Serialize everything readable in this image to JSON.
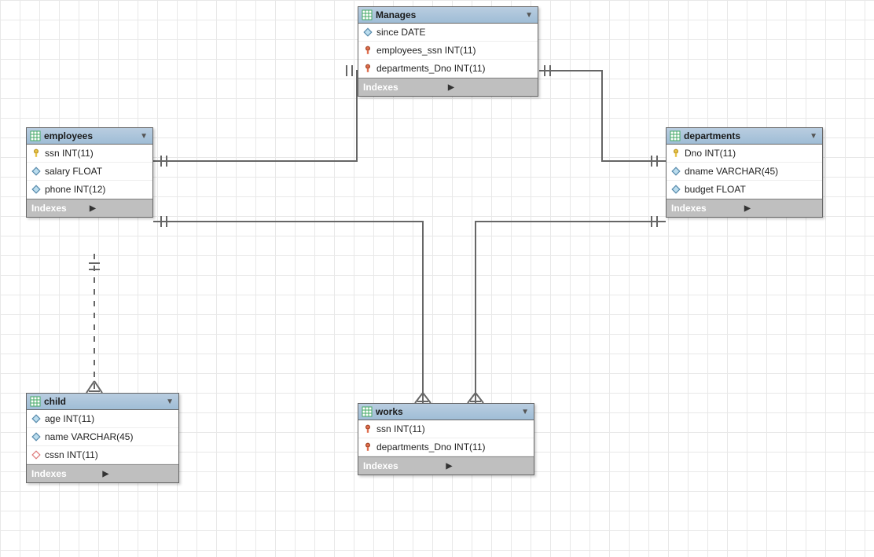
{
  "indexes_label": "Indexes",
  "tables": {
    "employees": {
      "name": "employees",
      "columns": [
        {
          "icon": "pk",
          "text": "ssn INT(11)"
        },
        {
          "icon": "attr",
          "text": "salary FLOAT"
        },
        {
          "icon": "attr",
          "text": "phone INT(12)"
        }
      ]
    },
    "manages": {
      "name": "Manages",
      "columns": [
        {
          "icon": "attr",
          "text": "since DATE"
        },
        {
          "icon": "fk",
          "text": "employees_ssn INT(11)"
        },
        {
          "icon": "fk",
          "text": "departments_Dno INT(11)"
        }
      ]
    },
    "departments": {
      "name": "departments",
      "columns": [
        {
          "icon": "pk",
          "text": "Dno INT(11)"
        },
        {
          "icon": "attr",
          "text": "dname VARCHAR(45)"
        },
        {
          "icon": "attr",
          "text": "budget FLOAT"
        }
      ]
    },
    "child": {
      "name": "child",
      "columns": [
        {
          "icon": "attr",
          "text": "age INT(11)"
        },
        {
          "icon": "attr",
          "text": "name VARCHAR(45)"
        },
        {
          "icon": "attr-open",
          "text": "cssn INT(11)"
        }
      ]
    },
    "works": {
      "name": "works",
      "columns": [
        {
          "icon": "fk",
          "text": "ssn INT(11)"
        },
        {
          "icon": "fk",
          "text": "departments_Dno INT(11)"
        }
      ]
    }
  }
}
